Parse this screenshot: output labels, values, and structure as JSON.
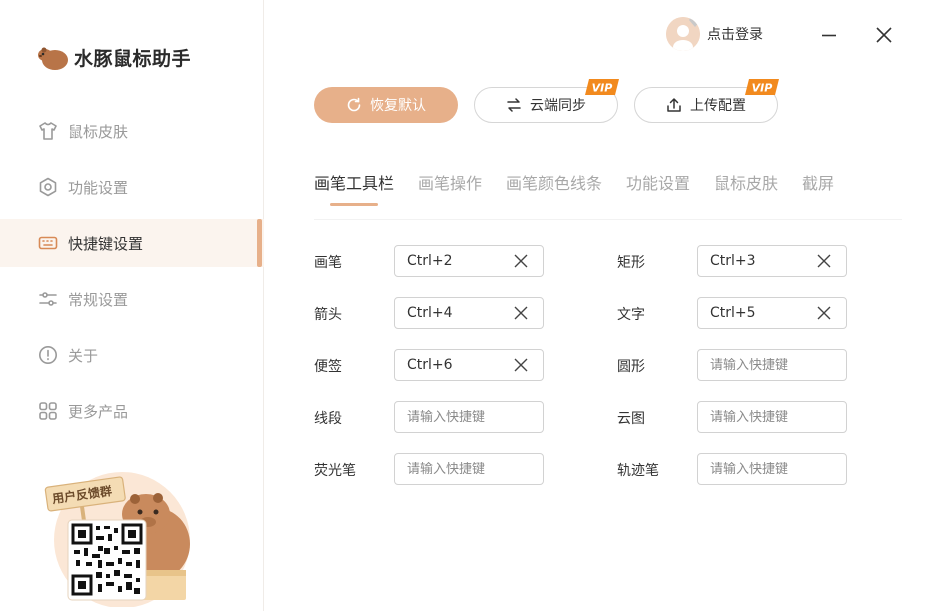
{
  "app": {
    "title": "水豚鼠标助手"
  },
  "sidebar": {
    "items": [
      {
        "label": "鼠标皮肤",
        "icon": "shirt-icon",
        "active": false
      },
      {
        "label": "功能设置",
        "icon": "hexagon-gear-icon",
        "active": false
      },
      {
        "label": "快捷键设置",
        "icon": "keyboard-icon",
        "active": true
      },
      {
        "label": "常规设置",
        "icon": "sliders-icon",
        "active": false
      },
      {
        "label": "关于",
        "icon": "info-icon",
        "active": false
      },
      {
        "label": "更多产品",
        "icon": "grid-icon",
        "active": false
      }
    ],
    "feedback": {
      "label": "用户反馈群",
      "qr": "qr-code-icon"
    }
  },
  "header": {
    "login_label": "点击登录"
  },
  "actions": {
    "restore_label": "恢复默认",
    "sync_label": "云端同步",
    "upload_label": "上传配置",
    "vip_badge": "VIP"
  },
  "tabs": [
    {
      "label": "画笔工具栏",
      "active": true
    },
    {
      "label": "画笔操作",
      "active": false
    },
    {
      "label": "画笔颜色线条",
      "active": false
    },
    {
      "label": "功能设置",
      "active": false
    },
    {
      "label": "鼠标皮肤",
      "active": false
    },
    {
      "label": "截屏",
      "active": false
    }
  ],
  "shortcuts": [
    {
      "label": "画笔",
      "value": "Ctrl+2"
    },
    {
      "label": "矩形",
      "value": "Ctrl+3"
    },
    {
      "label": "箭头",
      "value": "Ctrl+4"
    },
    {
      "label": "文字",
      "value": "Ctrl+5"
    },
    {
      "label": "便签",
      "value": "Ctrl+6"
    },
    {
      "label": "圆形",
      "value": ""
    },
    {
      "label": "线段",
      "value": ""
    },
    {
      "label": "云图",
      "value": ""
    },
    {
      "label": "荧光笔",
      "value": ""
    },
    {
      "label": "轨迹笔",
      "value": ""
    }
  ],
  "placeholder": "请输入快捷键",
  "colors": {
    "accent": "#e7b08a",
    "accent_dark": "#d88a56",
    "vip": "#f28a1e"
  }
}
